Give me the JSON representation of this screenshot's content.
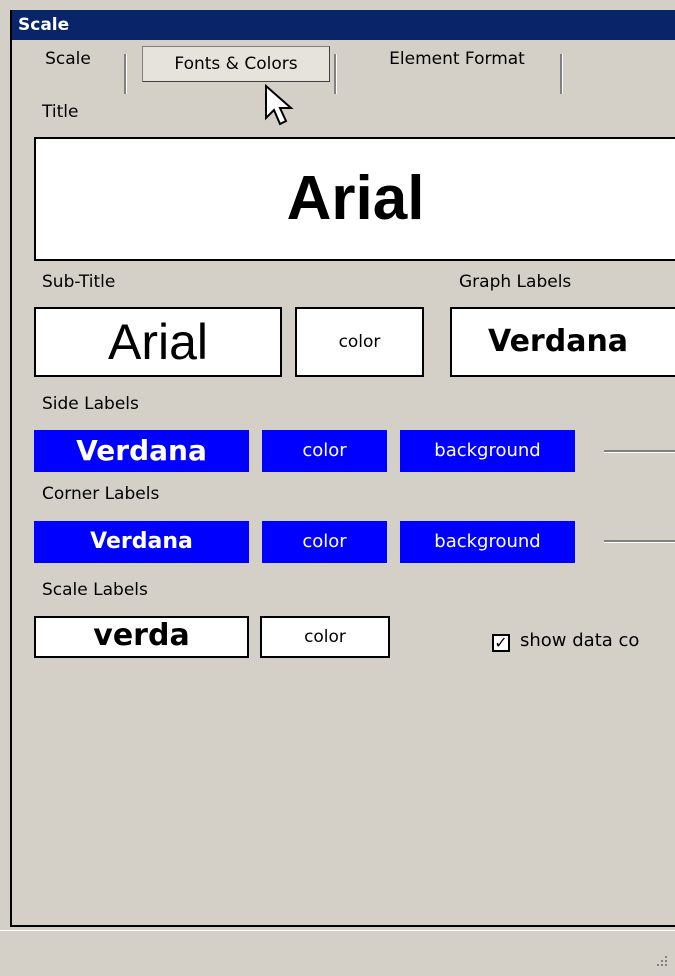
{
  "window": {
    "title": "Scale"
  },
  "tabs": [
    {
      "label": "Scale"
    },
    {
      "label": "Fonts & Colors"
    },
    {
      "label": "Element Format"
    }
  ],
  "title_section": {
    "label": "Title",
    "preview_font": "Arial"
  },
  "subtitle_section": {
    "label": "Sub-Title",
    "preview_font": "Arial",
    "color_button": "color"
  },
  "graph_labels_section": {
    "label": "Graph Labels",
    "preview_font": "Verdana"
  },
  "side_labels_section": {
    "label": "Side Labels",
    "preview_font": "Verdana",
    "color_button": "color",
    "background_button": "background"
  },
  "corner_labels_section": {
    "label": "Corner Labels",
    "preview_font": "Verdana",
    "color_button": "color",
    "background_button": "background"
  },
  "scale_labels_section": {
    "label": "Scale Labels",
    "preview_font": "verda",
    "color_button": "color"
  },
  "show_data_checkbox": {
    "label": "show data co",
    "checked": true
  },
  "colors": {
    "accent": "#0000ff",
    "titlebar": "#0a246a",
    "panel": "#d4d0c8"
  }
}
